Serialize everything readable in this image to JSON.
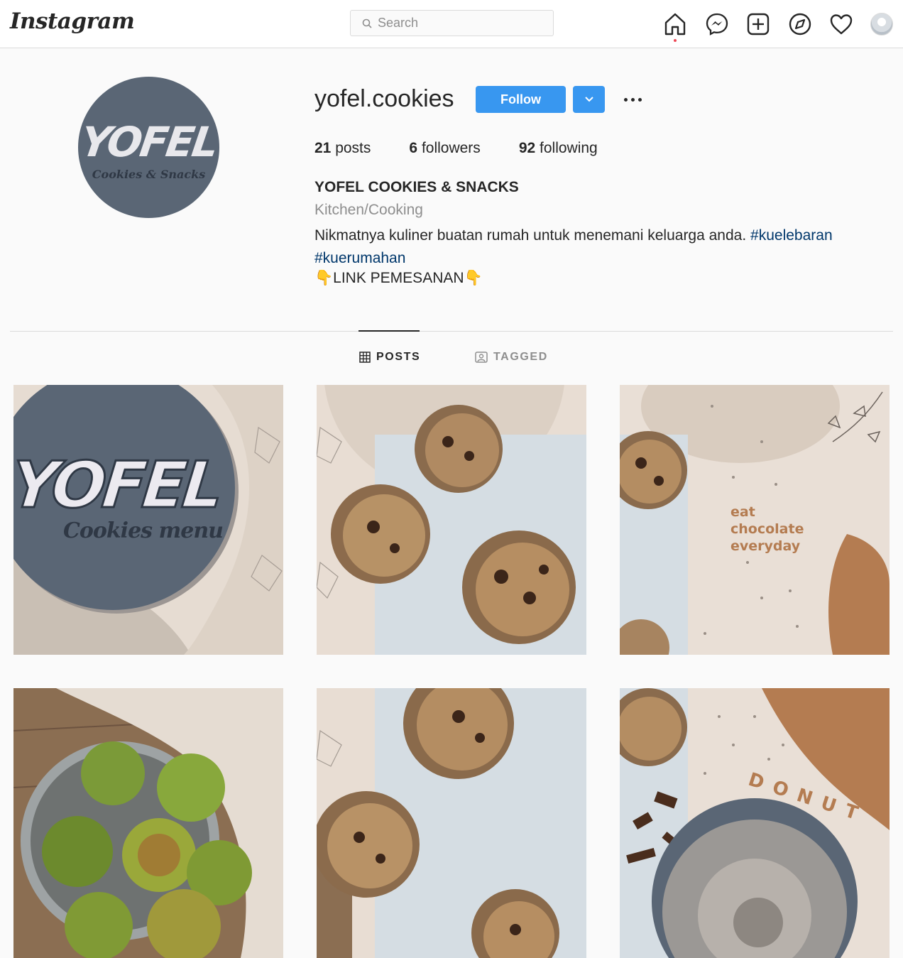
{
  "nav": {
    "logo": "Instagram",
    "search_placeholder": "Search",
    "icons": [
      "home-icon",
      "messenger-icon",
      "new-post-icon",
      "explore-icon",
      "activity-heart-icon",
      "profile-avatar"
    ]
  },
  "profile": {
    "avatar_text": "YOFEL",
    "avatar_subtext": "Cookies & Snacks",
    "username": "yofel.cookies",
    "follow_label": "Follow",
    "posts_count": "21",
    "posts_label": "posts",
    "followers_count": "6",
    "followers_label": "followers",
    "following_count": "92",
    "following_label": "following",
    "name": "YOFEL COOKIES & SNACKS",
    "category": "Kitchen/Cooking",
    "bio": "Nikmatnya kuliner buatan rumah untuk menemani keluarga anda.",
    "hashtag1": "#kuelebaran",
    "hashtag2": "#kuerumahan",
    "link_line": "👇LINK PEMESANAN👇"
  },
  "tabs": {
    "posts": "POSTS",
    "tagged": "TAGGED"
  },
  "posts": {
    "p1_title": "YOFEL",
    "p1_sub": "Cookies menu",
    "p3_line1": "eat",
    "p3_line2": "chocolate",
    "p3_line3": "everyday",
    "p6_word": "DONUT"
  },
  "colors": {
    "accent": "#3897f0",
    "hashtag": "#00376b",
    "beige": "#e9dfd6",
    "slate": "#5a6675"
  }
}
